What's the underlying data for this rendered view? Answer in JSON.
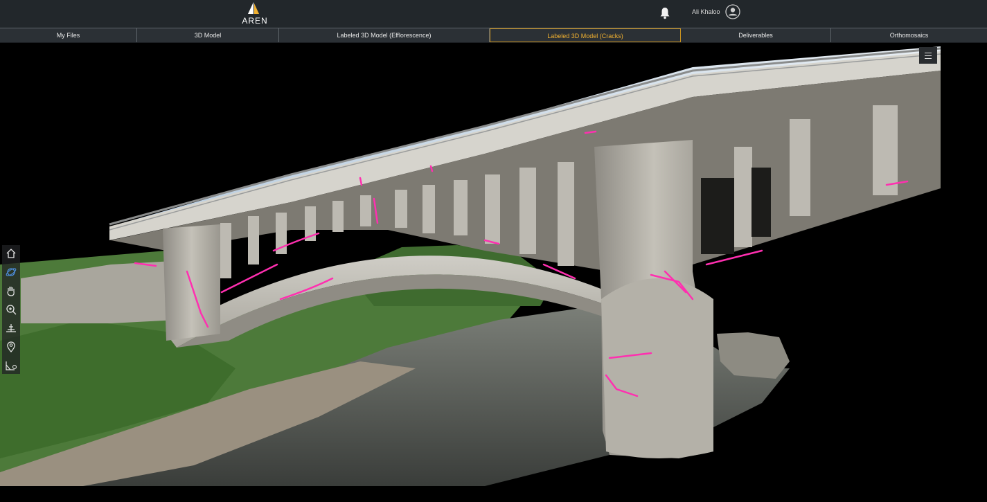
{
  "header": {
    "logo_text": "AREN",
    "user_name": "Ali Khaloo",
    "icons": [
      "bell-icon",
      "user-avatar-icon"
    ]
  },
  "tabs": [
    {
      "label": "My Files"
    },
    {
      "label": "3D Model"
    },
    {
      "label": "Labeled 3D Model (Efflorescence)"
    },
    {
      "label": "Labeled 3D Model (Cracks)",
      "active": true
    },
    {
      "label": "Deliverables"
    },
    {
      "label": "Orthomosaics"
    }
  ],
  "viewer": {
    "tools": [
      "home-icon",
      "orbit-icon",
      "pan-hand-icon",
      "zoom-icon",
      "measure-icon",
      "location-pin-icon",
      "area-measure-icon"
    ],
    "menu_icon": "hamburger-menu-icon"
  },
  "colors": {
    "accent": "#f0b030",
    "crack_label": "#ff2fb0",
    "header_bg": "#22272b",
    "tab_bg": "#2b3035"
  }
}
